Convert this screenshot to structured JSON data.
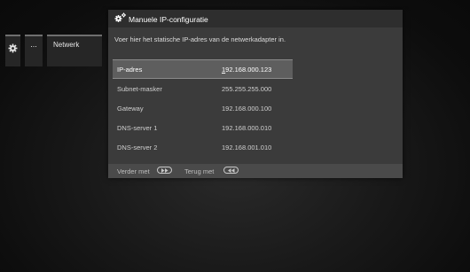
{
  "menu": {
    "gear_icon": "gear-icon",
    "more_label": "...",
    "section_label": "Netwerk"
  },
  "dialog": {
    "title_icon": "gears-icon",
    "title": "Manuele IP-configuratie",
    "instruction": "Voer hier het statische IP-adres van de netwerkadapter in.",
    "rows": [
      {
        "label": "IP-adres",
        "value_first": "1",
        "value_rest": "92.168.000.123",
        "selected": true
      },
      {
        "label": "Subnet-masker",
        "value": "255.255.255.000"
      },
      {
        "label": "Gateway",
        "value": "192.168.000.100"
      },
      {
        "label": "DNS-server 1",
        "value": "192.168.000.010"
      },
      {
        "label": "DNS-server 2",
        "value": "192.168.001.010"
      }
    ]
  },
  "footer": {
    "next_label": "Verder met",
    "next_icon": "fast-forward-button-icon",
    "back_label": "Terug met",
    "back_icon": "rewind-button-icon"
  }
}
